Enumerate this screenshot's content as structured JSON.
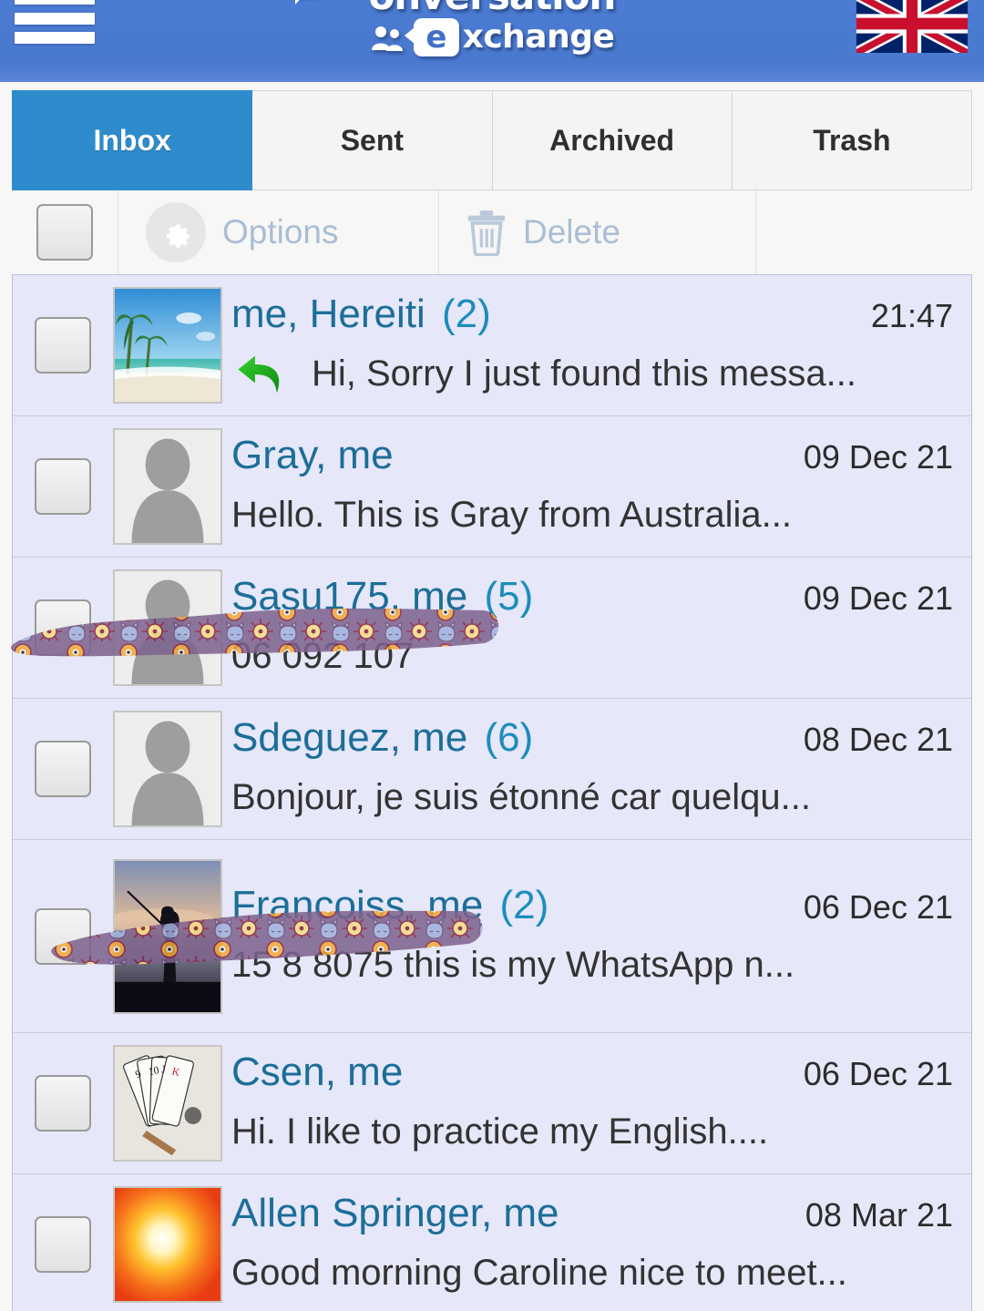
{
  "header": {
    "brand_line1": "onversation",
    "brand_line2": "xchange",
    "brand_e": "e",
    "menu_icon": "hamburger-menu-icon",
    "flag_label": "uk-flag"
  },
  "tabs": [
    {
      "label": "Inbox",
      "active": true
    },
    {
      "label": "Sent",
      "active": false
    },
    {
      "label": "Archived",
      "active": false
    },
    {
      "label": "Trash",
      "active": false
    }
  ],
  "action_bar": {
    "options_label": "Options",
    "delete_label": "Delete",
    "gear_icon": "gear-icon",
    "trash_icon": "trash-icon"
  },
  "messages": [
    {
      "sender": "me, Hereiti",
      "count": "(2)",
      "timestamp": "21:47",
      "preview": "Hi, Sorry I just found this messa...",
      "replied": true,
      "avatar": "beach",
      "redacted": false
    },
    {
      "sender": "Gray, me",
      "count": "",
      "timestamp": "09 Dec 21",
      "preview": "Hello. This is Gray from Australia...",
      "replied": false,
      "avatar": "person",
      "redacted": false
    },
    {
      "sender": "Sasu175, me",
      "count": "(5)",
      "timestamp": "09 Dec 21",
      "preview": "06 092 107",
      "replied": false,
      "avatar": "person",
      "redacted": true
    },
    {
      "sender": "Sdeguez, me",
      "count": "(6)",
      "timestamp": "08 Dec 21",
      "preview": "Bonjour, je suis étonné car quelqu...",
      "replied": false,
      "avatar": "person",
      "redacted": false
    },
    {
      "sender": "Francoiss, me",
      "count": "(2)",
      "timestamp": "06 Dec 21",
      "preview": "15 8 8075 this is my WhatsApp n...",
      "replied": false,
      "avatar": "fisher",
      "redacted": true
    },
    {
      "sender": "Csen, me",
      "count": "",
      "timestamp": "06 Dec 21",
      "preview": "Hi. I like to practice my English....",
      "replied": false,
      "avatar": "cards",
      "redacted": false
    },
    {
      "sender": "Allen Springer, me",
      "count": "",
      "timestamp": "08 Mar 21",
      "preview": "Good morning Caroline nice to meet...",
      "replied": false,
      "avatar": "sun",
      "redacted": false
    }
  ],
  "colors": {
    "header_blue": "#4a7ad1",
    "tab_active": "#2e8ccd",
    "row_bg": "#e6e7f8",
    "sender_blue": "#1c6e99",
    "disabled_text": "#a9bed6",
    "redaction_purple": "#7e638e"
  }
}
